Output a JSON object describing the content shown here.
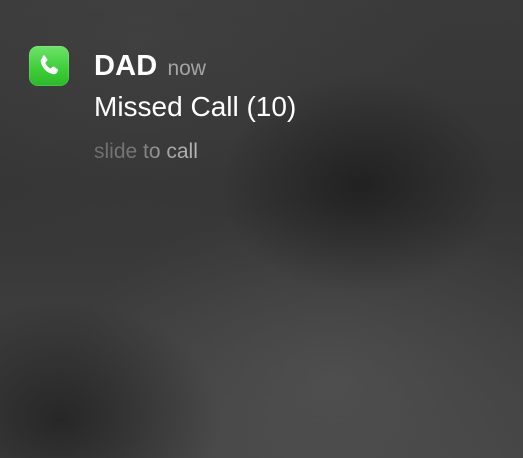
{
  "notification": {
    "app_icon": "phone-icon",
    "sender": "DAD",
    "time": "now",
    "message": "Missed Call (10)",
    "action_hint": "slide to call"
  },
  "colors": {
    "icon_green": "#4cd964",
    "text_primary": "#ffffff",
    "text_secondary": "#a4a4a4",
    "background": "#3a3a3a"
  }
}
